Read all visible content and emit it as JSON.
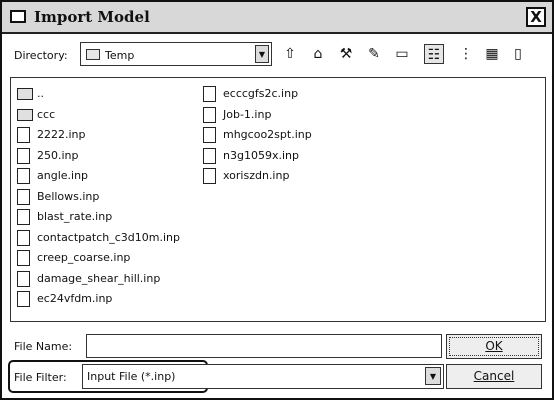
{
  "window": {
    "title": "Import Model",
    "close_label": "X"
  },
  "directory": {
    "label": "Directory:",
    "value": "Temp"
  },
  "toolbar": [
    {
      "name": "up-folder-icon",
      "glyph": "⇧"
    },
    {
      "name": "home-icon",
      "glyph": "⌂"
    },
    {
      "name": "hammer-icon",
      "glyph": "⚒"
    },
    {
      "name": "wand-icon",
      "glyph": "✎"
    },
    {
      "name": "new-folder-icon",
      "glyph": "▭"
    },
    {
      "name": "list-view-icon",
      "glyph": "☷"
    },
    {
      "name": "detail-view-icon",
      "glyph": "⋮"
    },
    {
      "name": "grid-view-icon",
      "glyph": "▦"
    },
    {
      "name": "clipboard-icon",
      "glyph": "▯"
    }
  ],
  "files": {
    "column1": [
      {
        "name": "..",
        "type": "folder"
      },
      {
        "name": "ccc",
        "type": "folder"
      },
      {
        "name": "2222.inp",
        "type": "file"
      },
      {
        "name": "250.inp",
        "type": "file"
      },
      {
        "name": "angle.inp",
        "type": "file"
      },
      {
        "name": "Bellows.inp",
        "type": "file"
      },
      {
        "name": "blast_rate.inp",
        "type": "file"
      },
      {
        "name": "contactpatch_c3d10m.inp",
        "type": "file"
      },
      {
        "name": "creep_coarse.inp",
        "type": "file"
      },
      {
        "name": "damage_shear_hill.inp",
        "type": "file"
      },
      {
        "name": "ec24vfdm.inp",
        "type": "file"
      }
    ],
    "column2": [
      {
        "name": "ecccgfs2c.inp",
        "type": "file"
      },
      {
        "name": "Job-1.inp",
        "type": "file"
      },
      {
        "name": "mhgcoo2spt.inp",
        "type": "file"
      },
      {
        "name": "n3g1059x.inp",
        "type": "file"
      },
      {
        "name": "xoriszdn.inp",
        "type": "file"
      }
    ]
  },
  "file_name": {
    "label": "File Name:",
    "value": ""
  },
  "file_filter": {
    "label": "File Filter:",
    "value": "Input File (*.inp)"
  },
  "buttons": {
    "ok": "OK",
    "cancel": "Cancel"
  }
}
